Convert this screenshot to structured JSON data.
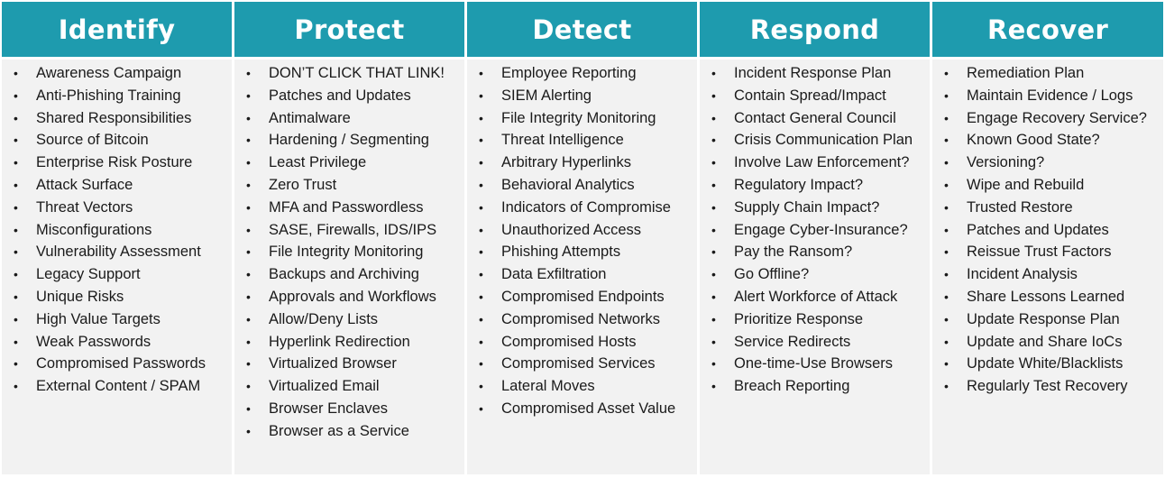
{
  "colors": {
    "header": "#1E9BAE",
    "body": "#F2F2F2",
    "header_text": "#FFFFFF"
  },
  "columns": [
    {
      "title": "Identify",
      "items": [
        "Awareness Campaign",
        "Anti-Phishing Training",
        "Shared Responsibilities",
        "Source of Bitcoin",
        "Enterprise Risk Posture",
        "Attack Surface",
        "Threat Vectors",
        "Misconfigurations",
        "Vulnerability Assessment",
        "Legacy Support",
        "Unique Risks",
        "High Value Targets",
        "Weak Passwords",
        "Compromised Passwords",
        "External Content / SPAM"
      ]
    },
    {
      "title": "Protect",
      "items": [
        "DON’T CLICK THAT LINK!",
        "Patches and Updates",
        "Antimalware",
        "Hardening / Segmenting",
        "Least Privilege",
        "Zero Trust",
        "MFA and Passwordless",
        "SASE, Firewalls, IDS/IPS",
        "File Integrity Monitoring",
        "Backups and Archiving",
        "Approvals and Workflows",
        "Allow/Deny Lists",
        "Hyperlink Redirection",
        "Virtualized Browser",
        "Virtualized Email",
        "Browser Enclaves",
        "Browser as a Service"
      ]
    },
    {
      "title": "Detect",
      "items": [
        "Employee Reporting",
        "SIEM Alerting",
        "File Integrity Monitoring",
        "Threat Intelligence",
        "Arbitrary Hyperlinks",
        "Behavioral Analytics",
        "Indicators of Compromise",
        "Unauthorized Access",
        "Phishing Attempts",
        "Data Exfiltration",
        "Compromised Endpoints",
        "Compromised Networks",
        "Compromised Hosts",
        "Compromised Services",
        "Lateral Moves",
        "Compromised Asset Value"
      ]
    },
    {
      "title": "Respond",
      "items": [
        "Incident Response Plan",
        "Contain Spread/Impact",
        "Contact General Council",
        "Crisis Communication Plan",
        "Involve Law Enforcement?",
        "Regulatory Impact?",
        "Supply Chain Impact?",
        "Engage Cyber-Insurance?",
        "Pay the Ransom?",
        "Go Offline?",
        "Alert Workforce of Attack",
        "Prioritize Response",
        "Service Redirects",
        "One-time-Use Browsers",
        "Breach Reporting"
      ]
    },
    {
      "title": "Recover",
      "items": [
        "Remediation Plan",
        "Maintain Evidence / Logs",
        "Engage Recovery Service?",
        "Known Good State?",
        "Versioning?",
        "Wipe and Rebuild",
        "Trusted Restore",
        "Patches and Updates",
        "Reissue Trust Factors",
        "Incident Analysis",
        "Share Lessons Learned",
        "Update Response Plan",
        "Update and Share IoCs",
        "Update White/Blacklists",
        "Regularly Test Recovery"
      ]
    }
  ]
}
